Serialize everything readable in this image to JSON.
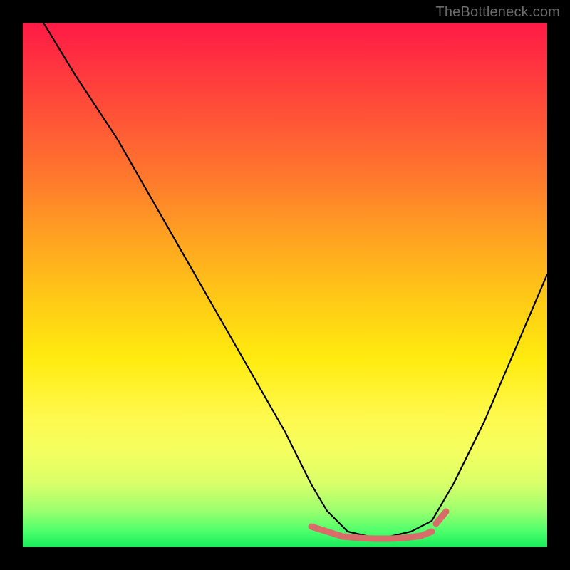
{
  "watermark": "TheBottleneck.com",
  "chart_data": {
    "type": "line",
    "title": "",
    "xlabel": "",
    "ylabel": "",
    "xlim": [
      0,
      100
    ],
    "ylim": [
      0,
      100
    ],
    "series": [
      {
        "name": "curve",
        "x": [
          4,
          10,
          18,
          26,
          34,
          42,
          50,
          55,
          58,
          62,
          66,
          70,
          74,
          78,
          82,
          88,
          94,
          100
        ],
        "values": [
          100,
          90,
          78,
          64,
          50,
          36,
          22,
          12,
          7,
          3,
          2,
          2,
          3,
          5,
          12,
          24,
          38,
          52
        ]
      },
      {
        "name": "bottom-marks",
        "x": [
          55,
          58,
          61,
          64,
          67,
          70,
          73,
          76,
          78,
          80
        ],
        "values": [
          4,
          3,
          2,
          1.8,
          1.6,
          1.6,
          1.8,
          2.2,
          3,
          5
        ]
      }
    ],
    "colors": {
      "curve": "#000000",
      "bottom_marks": "#d96b6b"
    }
  }
}
